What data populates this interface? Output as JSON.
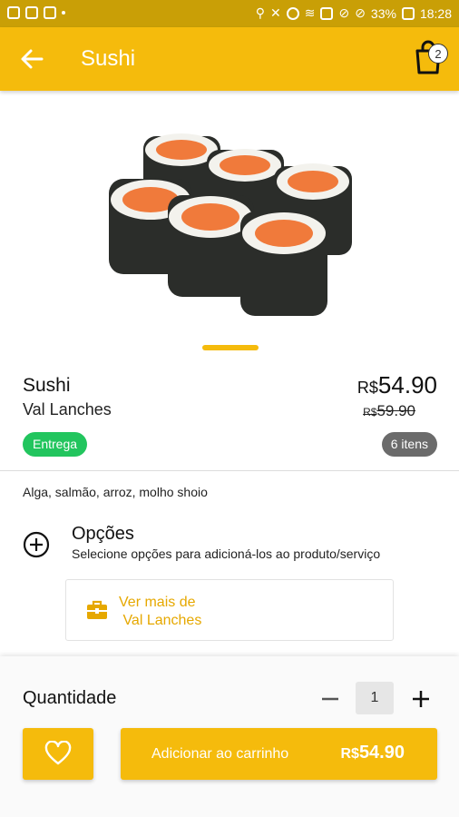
{
  "status_bar": {
    "battery": "33%",
    "time": "18:28"
  },
  "app_bar": {
    "title": "Sushi",
    "cart_count": "2"
  },
  "product": {
    "name": "Sushi",
    "store": "Val Lanches",
    "currency": "R$",
    "price": "54.90",
    "old_price": "59.90",
    "delivery_badge": "Entrega",
    "items_badge": "6 itens",
    "description": "Alga, salmão, arroz, molho shoio"
  },
  "options": {
    "title": "Opções",
    "subtitle": "Selecione opções para adicioná-los ao produto/serviço"
  },
  "store_link": {
    "label": "Ver mais de\n Val Lanches"
  },
  "footer": {
    "quantity_label": "Quantidade",
    "quantity": "1",
    "add_label": "Adicionar ao carrinho",
    "currency": "R$",
    "total": "54.90"
  },
  "colors": {
    "accent": "#f5bb0c",
    "status_bar": "#c99f06",
    "delivery": "#22c55e",
    "items_badge": "#6b6b6b"
  }
}
